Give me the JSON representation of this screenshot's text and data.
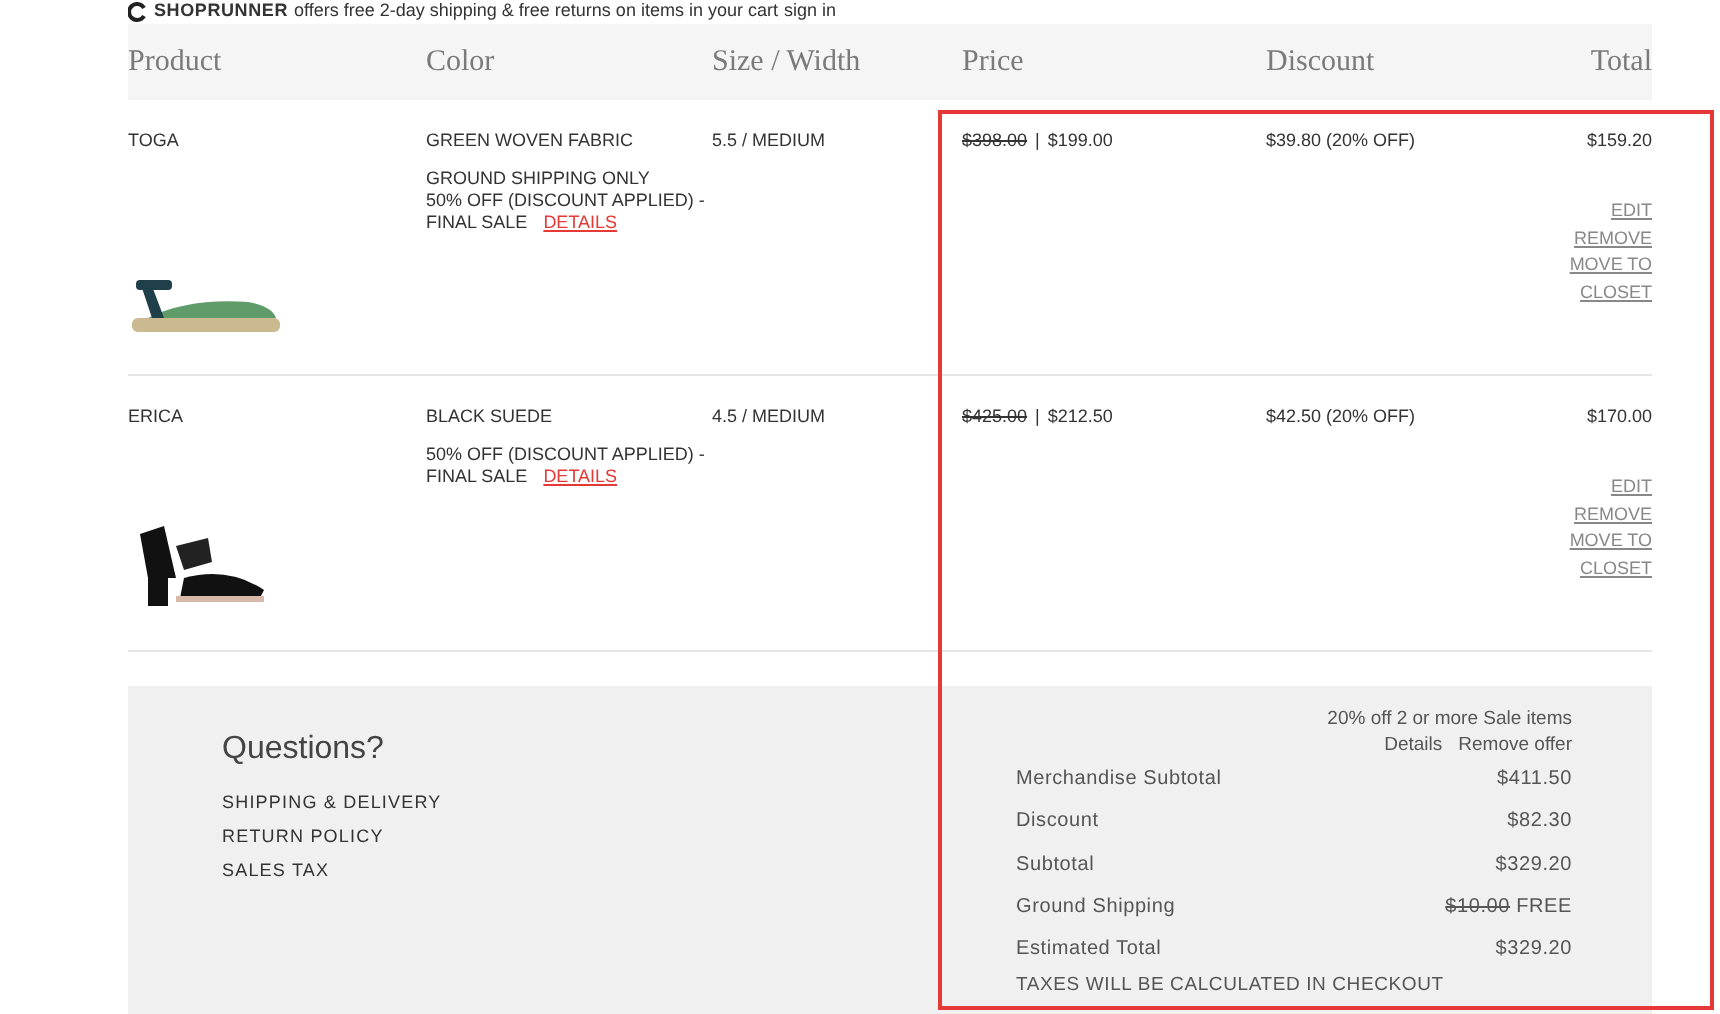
{
  "banner": {
    "brand": "SHOPRUNNER",
    "text": "offers free 2-day shipping & free returns on items in your cart",
    "link": "sign in"
  },
  "table": {
    "columns": [
      "Product",
      "Color",
      "Size / Width",
      "Price",
      "Discount",
      "Total"
    ],
    "rows": [
      {
        "product": "TOGA",
        "kind": "sandal",
        "fabric_color": "GREEN WOVEN FABRIC",
        "notes": [
          "GROUND SHIPPING ONLY",
          "50% OFF (DISCOUNT APPLIED) -",
          "FINAL SALE"
        ],
        "details_link": "DETAILS",
        "size": "5.5 / MEDIUM",
        "original_price": "$398.00",
        "price_separator": "|",
        "price": "$199.00",
        "discount": "$39.80 (20% OFF)",
        "total": "$159.20",
        "actions": [
          "EDIT",
          "REMOVE",
          "MOVE TO CLOSET"
        ]
      },
      {
        "product": "ERICA",
        "kind": "heel",
        "fabric_color": "BLACK SUEDE",
        "notes": [
          "50% OFF (DISCOUNT APPLIED) -",
          "FINAL SALE"
        ],
        "details_link": "DETAILS",
        "size": "4.5 / MEDIUM",
        "original_price": "$425.00",
        "price_separator": "|",
        "price": "$212.50",
        "discount": "$42.50 (20% OFF)",
        "total": "$170.00",
        "actions": [
          "EDIT",
          "REMOVE",
          "MOVE TO CLOSET"
        ]
      }
    ]
  },
  "questions": {
    "title": "Questions?",
    "links": [
      "SHIPPING & DELIVERY",
      "RETURN POLICY",
      "SALES TAX"
    ]
  },
  "summary": {
    "offer": "20% off 2 or more Sale items",
    "offer_links": [
      "Details",
      "Remove offer"
    ],
    "lines": [
      {
        "label": "Merchandise Subtotal",
        "value": "$411.50"
      },
      {
        "label": "Discount",
        "value": "$82.30"
      },
      {
        "label": "Subtotal",
        "value": "$329.20"
      },
      {
        "label": "Ground Shipping",
        "struck": "$10.00",
        "value": "FREE"
      },
      {
        "label": "Estimated Total",
        "value": "$329.20"
      }
    ],
    "note": "TAXES WILL BE CALCULATED IN CHECKOUT"
  },
  "highlight": {
    "color": "#e53935"
  }
}
